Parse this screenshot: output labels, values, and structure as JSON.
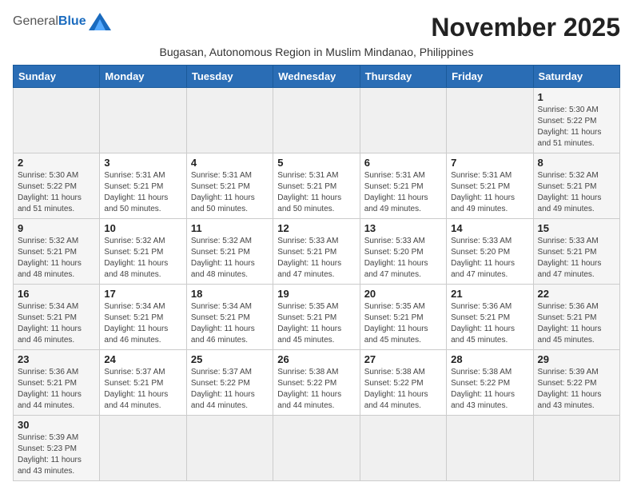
{
  "logo": {
    "general": "General",
    "blue": "Blue"
  },
  "title": "November 2025",
  "subtitle": "Bugasan, Autonomous Region in Muslim Mindanao, Philippines",
  "days_of_week": [
    "Sunday",
    "Monday",
    "Tuesday",
    "Wednesday",
    "Thursday",
    "Friday",
    "Saturday"
  ],
  "weeks": [
    [
      {
        "day": null,
        "info": null
      },
      {
        "day": null,
        "info": null
      },
      {
        "day": null,
        "info": null
      },
      {
        "day": null,
        "info": null
      },
      {
        "day": null,
        "info": null
      },
      {
        "day": null,
        "info": null
      },
      {
        "day": "1",
        "info": "Sunrise: 5:30 AM\nSunset: 5:22 PM\nDaylight: 11 hours\nand 51 minutes."
      }
    ],
    [
      {
        "day": "2",
        "info": "Sunrise: 5:30 AM\nSunset: 5:22 PM\nDaylight: 11 hours\nand 51 minutes."
      },
      {
        "day": "3",
        "info": "Sunrise: 5:31 AM\nSunset: 5:21 PM\nDaylight: 11 hours\nand 50 minutes."
      },
      {
        "day": "4",
        "info": "Sunrise: 5:31 AM\nSunset: 5:21 PM\nDaylight: 11 hours\nand 50 minutes."
      },
      {
        "day": "5",
        "info": "Sunrise: 5:31 AM\nSunset: 5:21 PM\nDaylight: 11 hours\nand 50 minutes."
      },
      {
        "day": "6",
        "info": "Sunrise: 5:31 AM\nSunset: 5:21 PM\nDaylight: 11 hours\nand 49 minutes."
      },
      {
        "day": "7",
        "info": "Sunrise: 5:31 AM\nSunset: 5:21 PM\nDaylight: 11 hours\nand 49 minutes."
      },
      {
        "day": "8",
        "info": "Sunrise: 5:32 AM\nSunset: 5:21 PM\nDaylight: 11 hours\nand 49 minutes."
      }
    ],
    [
      {
        "day": "9",
        "info": "Sunrise: 5:32 AM\nSunset: 5:21 PM\nDaylight: 11 hours\nand 48 minutes."
      },
      {
        "day": "10",
        "info": "Sunrise: 5:32 AM\nSunset: 5:21 PM\nDaylight: 11 hours\nand 48 minutes."
      },
      {
        "day": "11",
        "info": "Sunrise: 5:32 AM\nSunset: 5:21 PM\nDaylight: 11 hours\nand 48 minutes."
      },
      {
        "day": "12",
        "info": "Sunrise: 5:33 AM\nSunset: 5:21 PM\nDaylight: 11 hours\nand 47 minutes."
      },
      {
        "day": "13",
        "info": "Sunrise: 5:33 AM\nSunset: 5:20 PM\nDaylight: 11 hours\nand 47 minutes."
      },
      {
        "day": "14",
        "info": "Sunrise: 5:33 AM\nSunset: 5:20 PM\nDaylight: 11 hours\nand 47 minutes."
      },
      {
        "day": "15",
        "info": "Sunrise: 5:33 AM\nSunset: 5:21 PM\nDaylight: 11 hours\nand 47 minutes."
      }
    ],
    [
      {
        "day": "16",
        "info": "Sunrise: 5:34 AM\nSunset: 5:21 PM\nDaylight: 11 hours\nand 46 minutes."
      },
      {
        "day": "17",
        "info": "Sunrise: 5:34 AM\nSunset: 5:21 PM\nDaylight: 11 hours\nand 46 minutes."
      },
      {
        "day": "18",
        "info": "Sunrise: 5:34 AM\nSunset: 5:21 PM\nDaylight: 11 hours\nand 46 minutes."
      },
      {
        "day": "19",
        "info": "Sunrise: 5:35 AM\nSunset: 5:21 PM\nDaylight: 11 hours\nand 45 minutes."
      },
      {
        "day": "20",
        "info": "Sunrise: 5:35 AM\nSunset: 5:21 PM\nDaylight: 11 hours\nand 45 minutes."
      },
      {
        "day": "21",
        "info": "Sunrise: 5:36 AM\nSunset: 5:21 PM\nDaylight: 11 hours\nand 45 minutes."
      },
      {
        "day": "22",
        "info": "Sunrise: 5:36 AM\nSunset: 5:21 PM\nDaylight: 11 hours\nand 45 minutes."
      }
    ],
    [
      {
        "day": "23",
        "info": "Sunrise: 5:36 AM\nSunset: 5:21 PM\nDaylight: 11 hours\nand 44 minutes."
      },
      {
        "day": "24",
        "info": "Sunrise: 5:37 AM\nSunset: 5:21 PM\nDaylight: 11 hours\nand 44 minutes."
      },
      {
        "day": "25",
        "info": "Sunrise: 5:37 AM\nSunset: 5:22 PM\nDaylight: 11 hours\nand 44 minutes."
      },
      {
        "day": "26",
        "info": "Sunrise: 5:38 AM\nSunset: 5:22 PM\nDaylight: 11 hours\nand 44 minutes."
      },
      {
        "day": "27",
        "info": "Sunrise: 5:38 AM\nSunset: 5:22 PM\nDaylight: 11 hours\nand 44 minutes."
      },
      {
        "day": "28",
        "info": "Sunrise: 5:38 AM\nSunset: 5:22 PM\nDaylight: 11 hours\nand 43 minutes."
      },
      {
        "day": "29",
        "info": "Sunrise: 5:39 AM\nSunset: 5:22 PM\nDaylight: 11 hours\nand 43 minutes."
      }
    ],
    [
      {
        "day": "30",
        "info": "Sunrise: 5:39 AM\nSunset: 5:23 PM\nDaylight: 11 hours\nand 43 minutes."
      },
      {
        "day": null,
        "info": null
      },
      {
        "day": null,
        "info": null
      },
      {
        "day": null,
        "info": null
      },
      {
        "day": null,
        "info": null
      },
      {
        "day": null,
        "info": null
      },
      {
        "day": null,
        "info": null
      }
    ]
  ],
  "colors": {
    "header_bg": "#2a6db5",
    "weekend_bg": "#f5f5f5",
    "empty_bg": "#f0f0f0"
  }
}
